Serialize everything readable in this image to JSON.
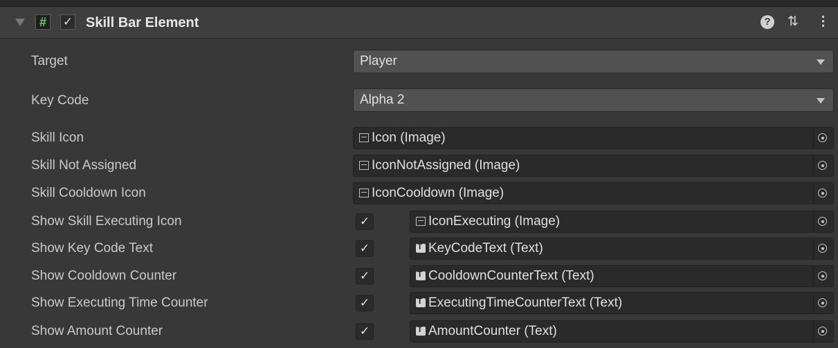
{
  "component": {
    "title": "Skill Bar Element",
    "script_icon_glyph": "#",
    "enabled_glyph": "✓",
    "icons": [
      "foldout-arrow-icon",
      "script-icon",
      "help-icon",
      "preset-icon",
      "more-options-icon"
    ]
  },
  "fields": {
    "target": {
      "label": "Target",
      "value": "Player"
    },
    "key_code": {
      "label": "Key Code",
      "value": "Alpha 2"
    },
    "skill_icon": {
      "label": "Skill Icon",
      "value": "Icon (Image)"
    },
    "skill_not_assigned": {
      "label": "Skill Not Assigned",
      "value": "IconNotAssigned (Image)"
    },
    "skill_cooldown_icon": {
      "label": "Skill Cooldown Icon",
      "value": "IconCooldown (Image)"
    },
    "show_skill_executing_icon": {
      "label": "Show Skill Executing Icon",
      "checked": "✓",
      "value": "IconExecuting (Image)"
    },
    "show_key_code_text": {
      "label": "Show Key Code Text",
      "checked": "✓",
      "value": "KeyCodeText (Text)"
    },
    "show_cooldown_counter": {
      "label": "Show Cooldown Counter",
      "checked": "✓",
      "value": "CooldownCounterText (Text)"
    },
    "show_executing_time_counter": {
      "label": "Show Executing Time Counter",
      "checked": "✓",
      "value": "ExecutingTimeCounterText (Text)"
    },
    "show_amount_counter": {
      "label": "Show Amount Counter",
      "checked": "✓",
      "value": "AmountCounter (Text)"
    }
  },
  "colors": {
    "background": "#383838",
    "header": "#3e3e3e",
    "field": "#2a2a2a",
    "dropdown": "#515151",
    "script_icon_green": "#5ed65e"
  }
}
